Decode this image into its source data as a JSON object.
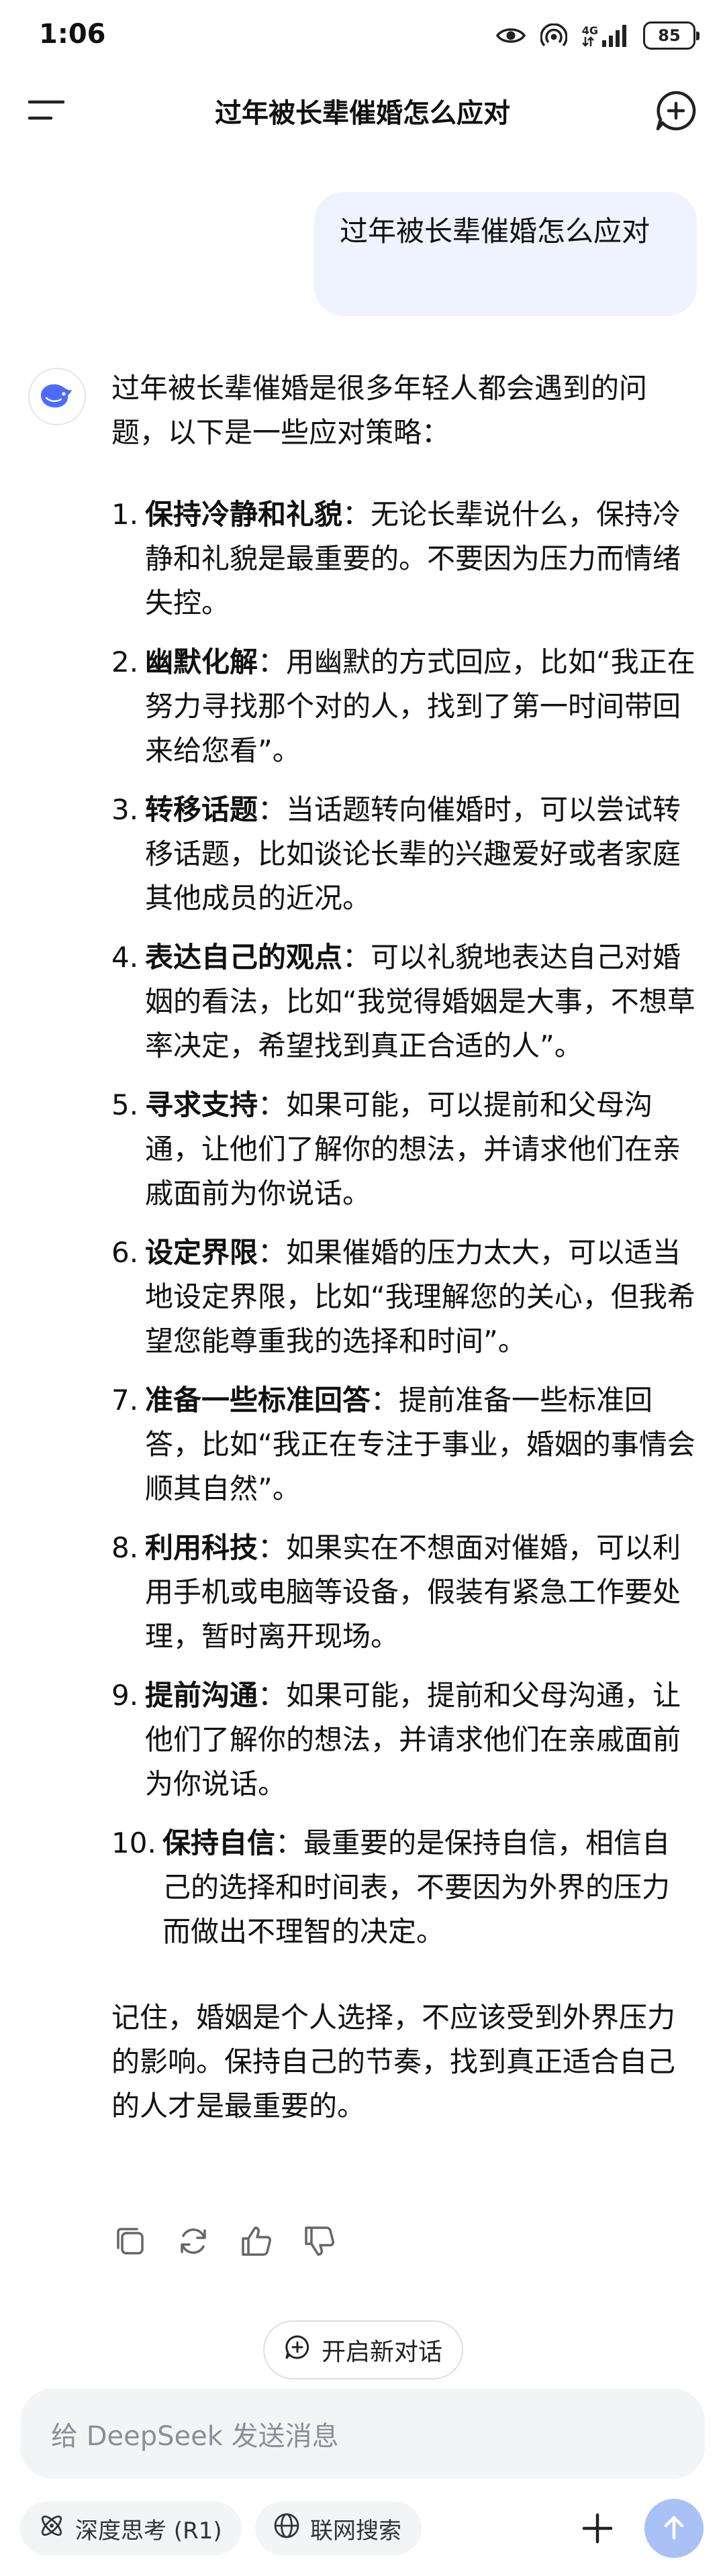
{
  "status_bar": {
    "time": "1:06",
    "network_label": "4G",
    "battery": "85",
    "icons": [
      "eye-icon",
      "hotspot-icon",
      "signal-icon",
      "battery-icon"
    ]
  },
  "header": {
    "title": "过年被长辈催婚怎么应对",
    "icons": [
      "menu-icon",
      "new-chat-icon"
    ]
  },
  "conversation": {
    "user_message": "过年被长辈催婚怎么应对",
    "answer": {
      "intro": "过年被长辈催婚是很多年轻人都会遇到的问题，以下是一些应对策略：",
      "items": [
        {
          "num": "1.",
          "title": "保持冷静和礼貌",
          "text": "：无论长辈说什么，保持冷静和礼貌是最重要的。不要因为压力而情绪失控。"
        },
        {
          "num": "2.",
          "title": "幽默化解",
          "text": "：用幽默的方式回应，比如“我正在努力寻找那个对的人，找到了第一时间带回来给您看”。"
        },
        {
          "num": "3.",
          "title": "转移话题",
          "text": "：当话题转向催婚时，可以尝试转移话题，比如谈论长辈的兴趣爱好或者家庭其他成员的近况。"
        },
        {
          "num": "4.",
          "title": "表达自己的观点",
          "text": "：可以礼貌地表达自己对婚姻的看法，比如“我觉得婚姻是大事，不想草率决定，希望找到真正合适的人”。"
        },
        {
          "num": "5.",
          "title": "寻求支持",
          "text": "：如果可能，可以提前和父母沟通，让他们了解你的想法，并请求他们在亲戚面前为你说话。"
        },
        {
          "num": "6.",
          "title": "设定界限",
          "text": "：如果催婚的压力太大，可以适当地设定界限，比如“我理解您的关心，但我希望您能尊重我的选择和时间”。"
        },
        {
          "num": "7.",
          "title": "准备一些标准回答",
          "text": "：提前准备一些标准回答，比如“我正在专注于事业，婚姻的事情会顺其自然”。"
        },
        {
          "num": "8.",
          "title": "利用科技",
          "text": "：如果实在不想面对催婚，可以利用手机或电脑等设备，假装有紧急工作要处理，暂时离开现场。"
        },
        {
          "num": "9.",
          "title": "提前沟通",
          "text": "：如果可能，提前和父母沟通，让他们了解你的想法，并请求他们在亲戚面前为你说话。"
        },
        {
          "num": "10.",
          "title": "保持自信",
          "text": "：最重要的是保持自信，相信自己的选择和时间表，不要因为外界的压力而做出不理智的决定。"
        }
      ],
      "closing": "记住，婚姻是个人选择，不应该受到外界压力的影响。保持自己的节奏，找到真正适合自己的人才是最重要的。"
    },
    "action_icons": [
      "copy-icon",
      "regenerate-icon",
      "thumbs-up-icon",
      "thumbs-down-icon"
    ]
  },
  "new_chat_button": "开启新对话",
  "composer": {
    "placeholder": "给 DeepSeek 发送消息",
    "deep_think_label": "深度思考 (R1)",
    "web_search_label": "联网搜索",
    "icons": [
      "atom-icon",
      "globe-icon",
      "plus-icon",
      "send-arrow-icon"
    ],
    "send_button_color": "#a9c1f4"
  },
  "colors": {
    "user_bubble_bg": "#eef3ff",
    "brand_blue": "#4d6bfe",
    "input_bg": "#f3f4f6"
  }
}
